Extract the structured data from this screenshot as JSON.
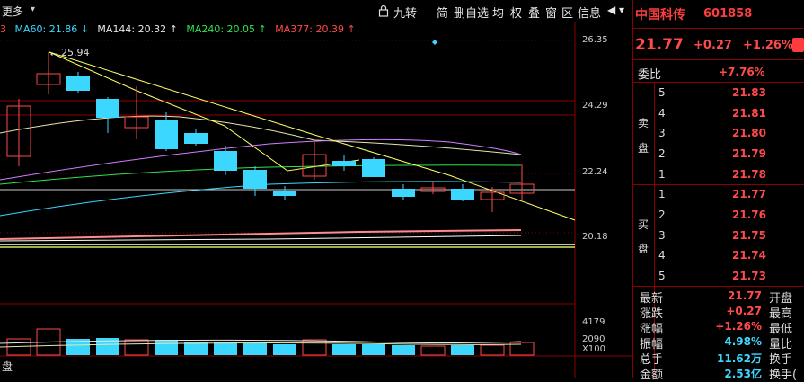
{
  "toolbar": {
    "menu_label": "更多",
    "items": [
      "九转",
      "简",
      "删自选",
      "均",
      "权",
      "叠",
      "窗",
      "区",
      "信息"
    ],
    "lock_icon": "lock-icon",
    "arrows": "◀ ▾"
  },
  "ma_row": {
    "prefix": "3",
    "ma60": "MA60: 21.86 ↓",
    "ma144": "MA144: 20.32 ↑",
    "ma240": "MA240: 20.05 ↑",
    "ma377": "MA377: 20.39 ↑",
    "colors": {
      "ma60": "#3cd7ff",
      "ma144": "#e6e6e6",
      "ma240": "#2ee34c",
      "ma377": "#ff4a4a"
    }
  },
  "chart": {
    "y_ticks": [
      "26.35",
      "24.29",
      "22.24",
      "20.18"
    ],
    "high_label": "25.94",
    "vol_ticks": [
      "4179",
      "2090",
      "X100"
    ],
    "bottom_label": "盘"
  },
  "stock": {
    "name": "中国科传",
    "code": "601858",
    "price": "21.77",
    "change": "+0.27",
    "change_pct": "+1.26%"
  },
  "order_book": {
    "ratio_label": "委比",
    "ratio_value": "+7.76%",
    "sell_label": [
      "卖",
      "盘"
    ],
    "buy_label": [
      "买",
      "盘"
    ],
    "sell": [
      {
        "level": "5",
        "price": "21.83"
      },
      {
        "level": "4",
        "price": "21.81"
      },
      {
        "level": "3",
        "price": "21.80"
      },
      {
        "level": "2",
        "price": "21.79"
      },
      {
        "level": "1",
        "price": "21.78"
      }
    ],
    "buy": [
      {
        "level": "1",
        "price": "21.77"
      },
      {
        "level": "2",
        "price": "21.76"
      },
      {
        "level": "3",
        "price": "21.75"
      },
      {
        "level": "4",
        "price": "21.74"
      },
      {
        "level": "5",
        "price": "21.73"
      }
    ]
  },
  "stats": [
    {
      "label": "最新",
      "value": "21.77",
      "color": "red",
      "right": "开盘"
    },
    {
      "label": "涨跌",
      "value": "+0.27",
      "color": "red",
      "right": "最高"
    },
    {
      "label": "涨幅",
      "value": "+1.26%",
      "color": "red",
      "right": "最低"
    },
    {
      "label": "振幅",
      "value": "4.98%",
      "color": "cyan",
      "right": "量比"
    },
    {
      "label": "总手",
      "value": "11.62万",
      "color": "cyan",
      "right": "换手"
    },
    {
      "label": "金额",
      "value": "2.53亿",
      "color": "cyan",
      "right": "换手("
    }
  ]
}
